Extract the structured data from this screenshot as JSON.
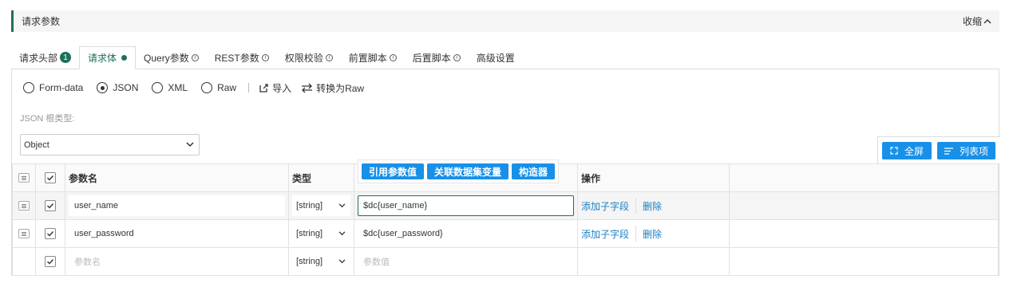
{
  "section": {
    "title": "请求参数",
    "collapse_label": "收缩"
  },
  "tabs": [
    {
      "label": "请求头部",
      "badge": "1"
    },
    {
      "label": "请求体"
    },
    {
      "label": "Query参数"
    },
    {
      "label": "REST参数"
    },
    {
      "label": "权限校验"
    },
    {
      "label": "前置脚本"
    },
    {
      "label": "后置脚本"
    },
    {
      "label": "高级设置"
    }
  ],
  "body_types": [
    {
      "label": "Form-data",
      "checked": false
    },
    {
      "label": "JSON",
      "checked": true
    },
    {
      "label": "XML",
      "checked": false
    },
    {
      "label": "Raw",
      "checked": false
    }
  ],
  "tools": {
    "import_label": "导入",
    "convert_label": "转换为Raw"
  },
  "root_type": {
    "label": "JSON 根类型:",
    "value": "Object"
  },
  "buttons": {
    "fullscreen": "全屏",
    "list_mode": "列表项"
  },
  "columns": {
    "name": "参数名",
    "type": "类型",
    "operation": "操作"
  },
  "value_popup": {
    "ref": "引用参数值",
    "dataset": "关联数据集变量",
    "builder": "构造器"
  },
  "rows": [
    {
      "name": "user_name",
      "type": "[string]",
      "value": "$dc{user_name}",
      "add_child": "添加子字段",
      "delete": "删除"
    },
    {
      "name": "user_password",
      "type": "[string]",
      "value": "$dc{user_password}",
      "add_child": "添加子字段",
      "delete": "删除"
    }
  ],
  "new_row": {
    "name_placeholder": "参数名",
    "type": "[string]",
    "value_placeholder": "参数值"
  },
  "colors": {
    "accent": "#1e6f5c",
    "button_blue": "#1890e8",
    "link": "#1a7fc6"
  }
}
